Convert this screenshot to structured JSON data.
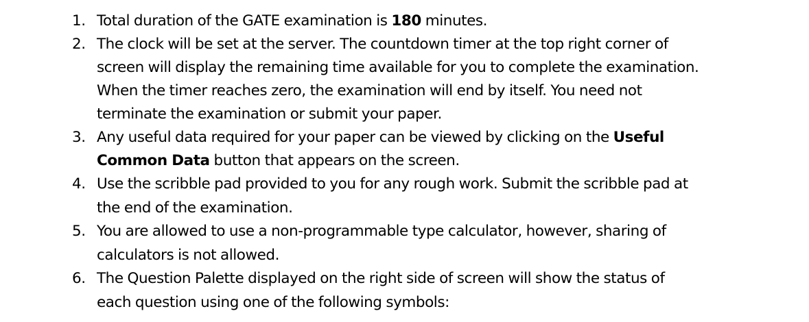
{
  "instructions": [
    {
      "number": "1.",
      "lines": [
        [
          "Total duration of the GATE examination is ",
          "180",
          " minutes."
        ]
      ]
    },
    {
      "number": "2.",
      "lines": [
        [
          "The clock will be set at the server. The countdown timer at the top right corner of"
        ],
        [
          "screen will display the remaining time available for you to complete the examination."
        ],
        [
          "When the timer reaches zero, the examination will end by itself. You need not"
        ],
        [
          "terminate the examination or submit your paper."
        ]
      ]
    },
    {
      "number": "3.",
      "lines": [
        [
          "Any useful data required for your paper can be viewed by clicking on the ",
          "Useful"
        ],
        [
          "",
          "Common Data",
          " button that appears on the screen."
        ]
      ]
    },
    {
      "number": "4.",
      "lines": [
        [
          "Use the scribble pad provided to you for any rough work. Submit the scribble pad at"
        ],
        [
          "the end of the examination."
        ]
      ]
    },
    {
      "number": "5.",
      "lines": [
        [
          "You are allowed to use a non-programmable type calculator, however, sharing of"
        ],
        [
          "calculators is not allowed."
        ]
      ]
    },
    {
      "number": "6.",
      "lines": [
        [
          "The Question Palette displayed on the right side of screen will show the status of"
        ],
        [
          "each question using one of the following symbols:"
        ]
      ]
    }
  ]
}
